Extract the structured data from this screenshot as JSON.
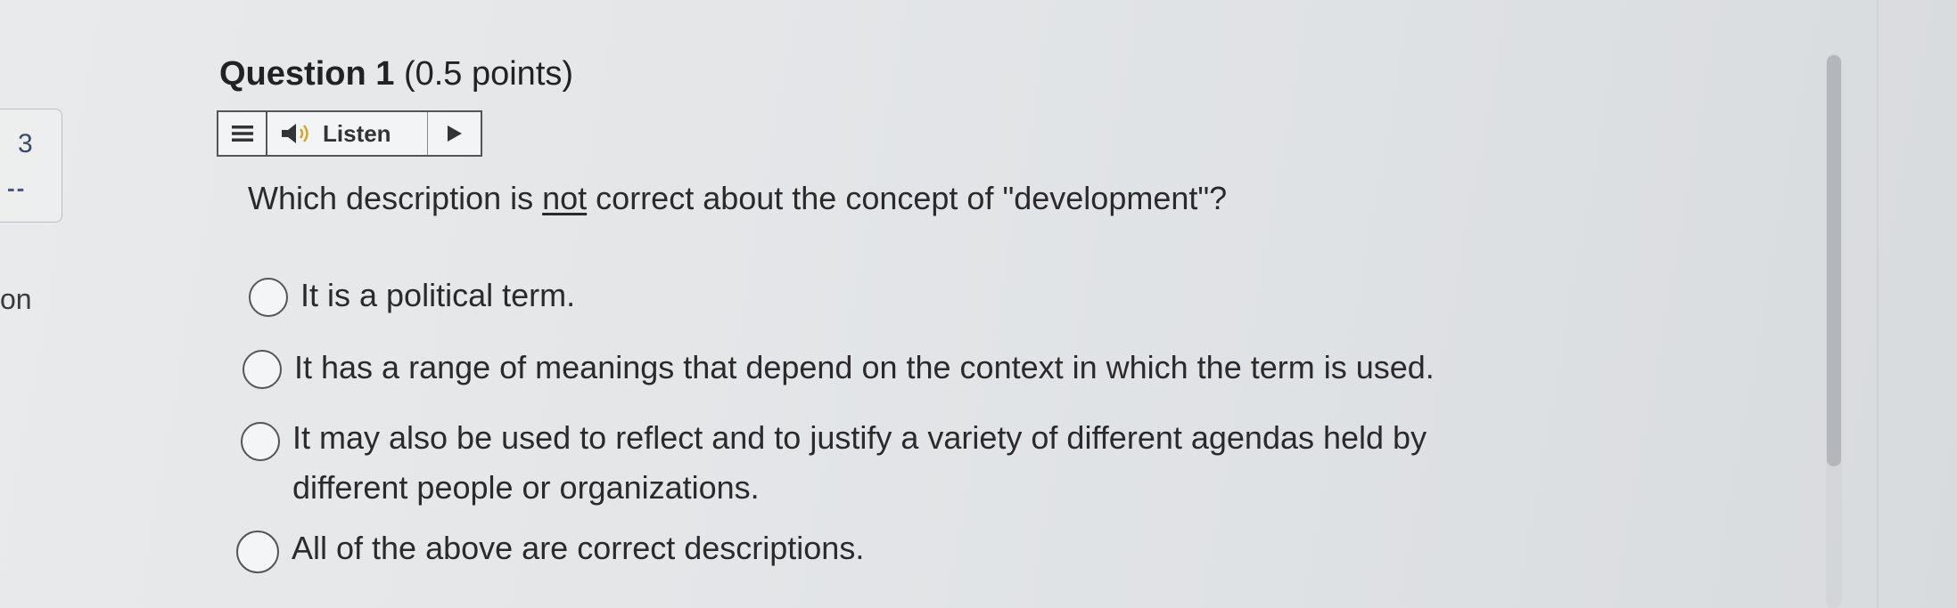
{
  "left_panel": {
    "number": "3",
    "dashes": "--",
    "partial_text": "on"
  },
  "question": {
    "title": "Question 1",
    "points": "(0.5 points)",
    "text_before": "Which description is ",
    "text_emphasis": "not",
    "text_after": " correct about the concept of \"development\"?"
  },
  "listen_toolbar": {
    "menu_icon": "hamburger-menu-icon",
    "speaker_icon": "speaker-icon",
    "label": "Listen",
    "play_icon": "play-icon"
  },
  "options": [
    {
      "line1": "It is a political term.",
      "line2": ""
    },
    {
      "line1": "It has a range of meanings that depend on the context in which the term is used.",
      "line2": ""
    },
    {
      "line1": "It may also be used to reflect and to justify a variety of different agendas held by",
      "line2": "different people or organizations."
    },
    {
      "line1": "All of the above are correct descriptions.",
      "line2": ""
    }
  ]
}
